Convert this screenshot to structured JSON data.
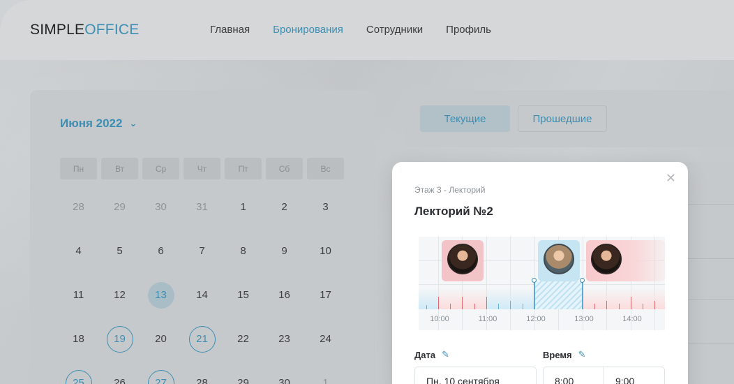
{
  "header": {
    "logo_main": "SIMPLE",
    "logo_accent": "OFFICE",
    "nav": [
      {
        "label": "Главная",
        "active": false
      },
      {
        "label": "Бронирования",
        "active": true
      },
      {
        "label": "Сотрудники",
        "active": false
      },
      {
        "label": "Профиль",
        "active": false
      }
    ]
  },
  "calendar": {
    "month_label": "Июня 2022",
    "chevron_icon": "chevron-down-icon",
    "weekdays": [
      "Пн",
      "Вт",
      "Ср",
      "Чт",
      "Пт",
      "Сб",
      "Вс"
    ],
    "days": [
      {
        "d": "28",
        "state": "muted"
      },
      {
        "d": "29",
        "state": "muted"
      },
      {
        "d": "30",
        "state": "muted"
      },
      {
        "d": "31",
        "state": "muted"
      },
      {
        "d": "1",
        "state": ""
      },
      {
        "d": "2",
        "state": ""
      },
      {
        "d": "3",
        "state": ""
      },
      {
        "d": "4",
        "state": ""
      },
      {
        "d": "5",
        "state": ""
      },
      {
        "d": "6",
        "state": ""
      },
      {
        "d": "7",
        "state": ""
      },
      {
        "d": "8",
        "state": ""
      },
      {
        "d": "9",
        "state": ""
      },
      {
        "d": "10",
        "state": ""
      },
      {
        "d": "11",
        "state": ""
      },
      {
        "d": "12",
        "state": ""
      },
      {
        "d": "13",
        "state": "selected"
      },
      {
        "d": "14",
        "state": ""
      },
      {
        "d": "15",
        "state": ""
      },
      {
        "d": "16",
        "state": ""
      },
      {
        "d": "17",
        "state": ""
      },
      {
        "d": "18",
        "state": ""
      },
      {
        "d": "19",
        "state": "booked"
      },
      {
        "d": "20",
        "state": ""
      },
      {
        "d": "21",
        "state": "booked"
      },
      {
        "d": "22",
        "state": ""
      },
      {
        "d": "23",
        "state": ""
      },
      {
        "d": "24",
        "state": ""
      },
      {
        "d": "25",
        "state": "booked"
      },
      {
        "d": "26",
        "state": ""
      },
      {
        "d": "27",
        "state": "booked"
      },
      {
        "d": "28",
        "state": ""
      },
      {
        "d": "29",
        "state": ""
      },
      {
        "d": "30",
        "state": ""
      },
      {
        "d": "1",
        "state": "muted"
      }
    ]
  },
  "bookings_tabs": {
    "current": "Текущие",
    "past": "Прошедшие"
  },
  "modal": {
    "close_icon": "close-icon",
    "breadcrumb": "Этаж 3 - Лекторий",
    "title": "Лекторий №2",
    "timeline_labels": [
      "10:00",
      "11:00",
      "12:00",
      "13:00",
      "14:00"
    ],
    "date_label": "Дата",
    "time_label": "Время",
    "edit_icon": "pencil-icon",
    "date_value": "Пн, 10 сентября",
    "time_from": "8:00",
    "time_to": "9:00"
  },
  "colors": {
    "accent": "#3d8eb3",
    "busy": "#e06a72",
    "free": "#64b2d8"
  }
}
